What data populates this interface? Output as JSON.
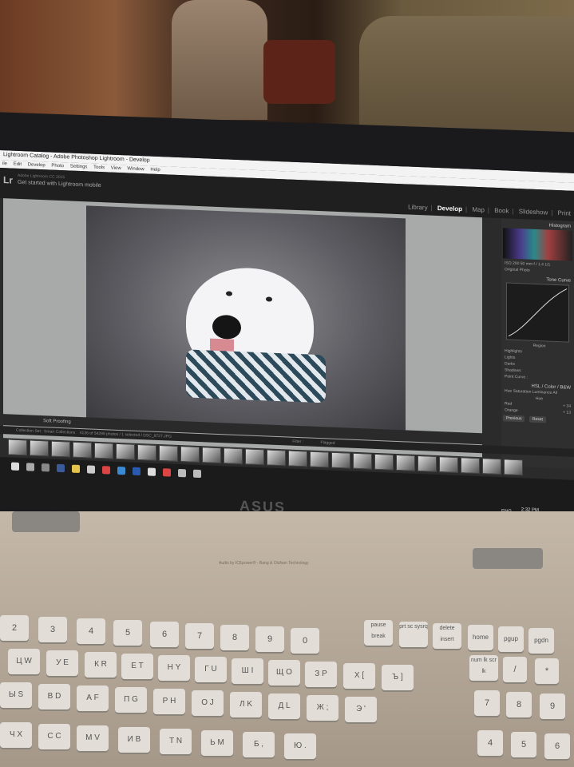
{
  "app": {
    "window_title": "Lightroom Catalog - Adobe Photoshop Lightroom - Develop",
    "menu": [
      "ile",
      "Edit",
      "Develop",
      "Photo",
      "Settings",
      "Tools",
      "View",
      "Window",
      "Help"
    ],
    "logo": "Lr",
    "subtitle": "Adobe Lightroom CC 2015",
    "mobile_prompt": "Get started with Lightroom mobile",
    "modules": [
      "Library",
      "Develop",
      "Map",
      "Book",
      "Slideshow",
      "Print"
    ],
    "active_module": "Develop"
  },
  "right_panel": {
    "histogram_label": "Histogram",
    "iso": "ISO 200",
    "focal": "50 mm",
    "aperture": "f / 1.4",
    "shutter": "1/1",
    "original_photo": "Original Photo",
    "tone_curve": "Tone Curve",
    "region": "Region",
    "sliders": [
      "Highlights",
      "Lights",
      "Darks",
      "Shadows"
    ],
    "point_curve": "Point Curve :",
    "hsl": "HSL / Color / B&W",
    "hsl_tabs": [
      "Hue",
      "Saturation",
      "Luminance",
      "All"
    ],
    "hue_label": "Hue",
    "hue_rows": [
      "Red",
      "Orange"
    ],
    "hue_values": [
      "+ 34",
      "+ 13"
    ],
    "previous_button": "Previous",
    "reset_button": "Reset"
  },
  "toolbar": {
    "soft_proofing": "Soft Proofing"
  },
  "filmstrip": {
    "collection": "Collection Set : Smart Collections",
    "count_info": "4136 of 54298 photos / 1 selected / DSC_8727.JPG",
    "filter_label": "Filter :",
    "flagged_label": "Flagged"
  },
  "taskbar": {
    "lang": "ENG",
    "time": "2:32 PM",
    "date": "2017-10-11"
  },
  "laptop": {
    "brand": "ASUS",
    "audio_text": "Audio by ICEpower® - Bang & Olufsen Technology"
  },
  "keyboard": {
    "row1": [
      "2",
      "3",
      "4",
      "5",
      "6",
      "7",
      "8",
      "9",
      "0",
      "pause break",
      "prt sc sysrq",
      "delete insert",
      "home",
      "pgup",
      "pgdn"
    ],
    "row2": [
      "Ц W",
      "У E",
      "К R",
      "Е T",
      "Н Y",
      "Г U",
      "Ш I",
      "Щ O",
      "З P",
      "Х [",
      "Ъ ]",
      "num lk scr lk",
      "/",
      "*"
    ],
    "row3": [
      "Ы S",
      "В D",
      "А F",
      "П G",
      "Р H",
      "О J",
      "Л K",
      "Д L",
      "Ж ;",
      "Э '",
      "7",
      "8",
      "9"
    ],
    "row4": [
      "Ч X",
      "С C",
      "М V",
      "И B",
      "Т N",
      "Ь M",
      "Б ,",
      "Ю .",
      "4",
      "5",
      "6"
    ]
  }
}
